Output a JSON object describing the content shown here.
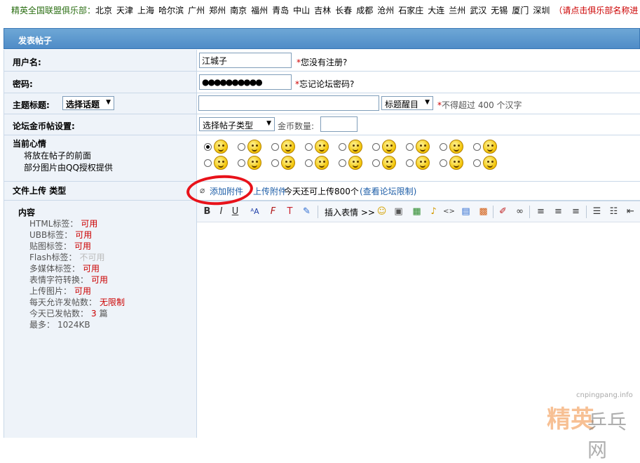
{
  "top_nav": {
    "label": "精英全国联盟俱乐部：",
    "cities": [
      "北京",
      "天津",
      "上海",
      "哈尔滨",
      "广州",
      "郑州",
      "南京",
      "福州",
      "青岛",
      "中山",
      "吉林",
      "长春",
      "成都",
      "沧州",
      "石家庄",
      "大连",
      "兰州",
      "武汉",
      "无锡",
      "厦门",
      "深圳"
    ],
    "note": "（请点击俱乐部名称进"
  },
  "header": {
    "title": "发表帖子"
  },
  "username": {
    "label": "用户名:",
    "value": "江城子",
    "hint": "*您没有注册?"
  },
  "password": {
    "label": "密码:",
    "value": "●●●●●●●●●●",
    "hint": "*忘记论坛密码?"
  },
  "subject": {
    "label": "主题标题:",
    "topic_select": "选择话题",
    "style_select": "标题醒目",
    "hint_star": "*",
    "hint": "不得超过 400 个汉字"
  },
  "coin": {
    "label": "论坛金币帖设置:",
    "type_select": "选择帖子类型",
    "amount_label": "金币数量:"
  },
  "mood": {
    "title": "当前心情",
    "line1": "将放在帖子的前面",
    "line2": "部分图片由QQ授权提供"
  },
  "upload": {
    "label": "文件上传",
    "label2": "类型",
    "add_attachment": "添加附件",
    "upload_attachment": "上传附件",
    "quota": "今天还可上传800个",
    "limit_link": "(查看论坛限制)"
  },
  "content_info": {
    "title": "内容",
    "items": [
      {
        "k": "HTML标签：",
        "v": "可用"
      },
      {
        "k": "UBB标签：",
        "v": "可用"
      },
      {
        "k": "贴图标签：",
        "v": "可用"
      },
      {
        "k": "Flash标签：",
        "v": "不可用"
      },
      {
        "k": "多媒体标签：",
        "v": "可用"
      },
      {
        "k": "表情字符转换：",
        "v": "可用"
      },
      {
        "k": "上传图片：",
        "v": "可用"
      },
      {
        "k": "每天允许发帖数：",
        "v": "无限制"
      },
      {
        "k": "今天已发帖数：",
        "v": "3",
        "suffix": "篇"
      },
      {
        "k": "最多：",
        "v": "1024KB"
      }
    ]
  },
  "toolbar": {
    "insert_emoji": "插入表情 >>"
  },
  "watermark": {
    "url": "cnpingpang.info",
    "brand1": "精英",
    "brand2": "乒乓网"
  },
  "colors": {
    "accent": "#4f8cc7",
    "red_annotation": "#e8121a",
    "available": "#cc0000"
  }
}
